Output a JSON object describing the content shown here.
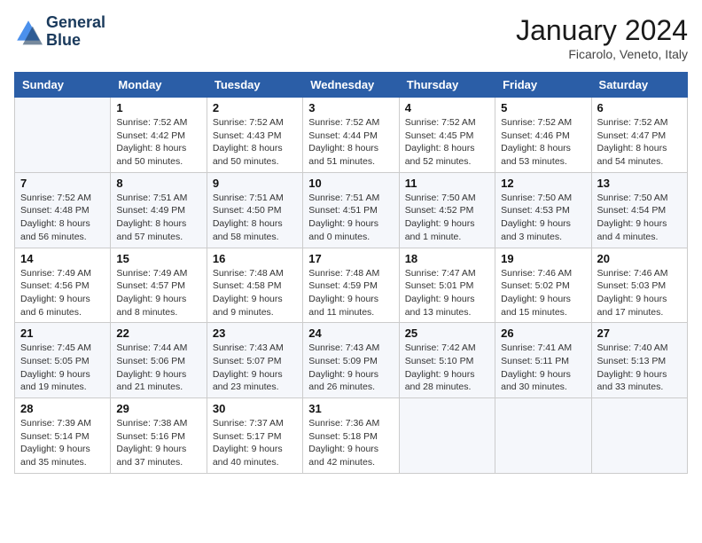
{
  "header": {
    "logo_line1": "General",
    "logo_line2": "Blue",
    "month": "January 2024",
    "location": "Ficarolo, Veneto, Italy"
  },
  "weekdays": [
    "Sunday",
    "Monday",
    "Tuesday",
    "Wednesday",
    "Thursday",
    "Friday",
    "Saturday"
  ],
  "weeks": [
    [
      {
        "day": "",
        "sunrise": "",
        "sunset": "",
        "daylight": ""
      },
      {
        "day": "1",
        "sunrise": "Sunrise: 7:52 AM",
        "sunset": "Sunset: 4:42 PM",
        "daylight": "Daylight: 8 hours and 50 minutes."
      },
      {
        "day": "2",
        "sunrise": "Sunrise: 7:52 AM",
        "sunset": "Sunset: 4:43 PM",
        "daylight": "Daylight: 8 hours and 50 minutes."
      },
      {
        "day": "3",
        "sunrise": "Sunrise: 7:52 AM",
        "sunset": "Sunset: 4:44 PM",
        "daylight": "Daylight: 8 hours and 51 minutes."
      },
      {
        "day": "4",
        "sunrise": "Sunrise: 7:52 AM",
        "sunset": "Sunset: 4:45 PM",
        "daylight": "Daylight: 8 hours and 52 minutes."
      },
      {
        "day": "5",
        "sunrise": "Sunrise: 7:52 AM",
        "sunset": "Sunset: 4:46 PM",
        "daylight": "Daylight: 8 hours and 53 minutes."
      },
      {
        "day": "6",
        "sunrise": "Sunrise: 7:52 AM",
        "sunset": "Sunset: 4:47 PM",
        "daylight": "Daylight: 8 hours and 54 minutes."
      }
    ],
    [
      {
        "day": "7",
        "sunrise": "Sunrise: 7:52 AM",
        "sunset": "Sunset: 4:48 PM",
        "daylight": "Daylight: 8 hours and 56 minutes."
      },
      {
        "day": "8",
        "sunrise": "Sunrise: 7:51 AM",
        "sunset": "Sunset: 4:49 PM",
        "daylight": "Daylight: 8 hours and 57 minutes."
      },
      {
        "day": "9",
        "sunrise": "Sunrise: 7:51 AM",
        "sunset": "Sunset: 4:50 PM",
        "daylight": "Daylight: 8 hours and 58 minutes."
      },
      {
        "day": "10",
        "sunrise": "Sunrise: 7:51 AM",
        "sunset": "Sunset: 4:51 PM",
        "daylight": "Daylight: 9 hours and 0 minutes."
      },
      {
        "day": "11",
        "sunrise": "Sunrise: 7:50 AM",
        "sunset": "Sunset: 4:52 PM",
        "daylight": "Daylight: 9 hours and 1 minute."
      },
      {
        "day": "12",
        "sunrise": "Sunrise: 7:50 AM",
        "sunset": "Sunset: 4:53 PM",
        "daylight": "Daylight: 9 hours and 3 minutes."
      },
      {
        "day": "13",
        "sunrise": "Sunrise: 7:50 AM",
        "sunset": "Sunset: 4:54 PM",
        "daylight": "Daylight: 9 hours and 4 minutes."
      }
    ],
    [
      {
        "day": "14",
        "sunrise": "Sunrise: 7:49 AM",
        "sunset": "Sunset: 4:56 PM",
        "daylight": "Daylight: 9 hours and 6 minutes."
      },
      {
        "day": "15",
        "sunrise": "Sunrise: 7:49 AM",
        "sunset": "Sunset: 4:57 PM",
        "daylight": "Daylight: 9 hours and 8 minutes."
      },
      {
        "day": "16",
        "sunrise": "Sunrise: 7:48 AM",
        "sunset": "Sunset: 4:58 PM",
        "daylight": "Daylight: 9 hours and 9 minutes."
      },
      {
        "day": "17",
        "sunrise": "Sunrise: 7:48 AM",
        "sunset": "Sunset: 4:59 PM",
        "daylight": "Daylight: 9 hours and 11 minutes."
      },
      {
        "day": "18",
        "sunrise": "Sunrise: 7:47 AM",
        "sunset": "Sunset: 5:01 PM",
        "daylight": "Daylight: 9 hours and 13 minutes."
      },
      {
        "day": "19",
        "sunrise": "Sunrise: 7:46 AM",
        "sunset": "Sunset: 5:02 PM",
        "daylight": "Daylight: 9 hours and 15 minutes."
      },
      {
        "day": "20",
        "sunrise": "Sunrise: 7:46 AM",
        "sunset": "Sunset: 5:03 PM",
        "daylight": "Daylight: 9 hours and 17 minutes."
      }
    ],
    [
      {
        "day": "21",
        "sunrise": "Sunrise: 7:45 AM",
        "sunset": "Sunset: 5:05 PM",
        "daylight": "Daylight: 9 hours and 19 minutes."
      },
      {
        "day": "22",
        "sunrise": "Sunrise: 7:44 AM",
        "sunset": "Sunset: 5:06 PM",
        "daylight": "Daylight: 9 hours and 21 minutes."
      },
      {
        "day": "23",
        "sunrise": "Sunrise: 7:43 AM",
        "sunset": "Sunset: 5:07 PM",
        "daylight": "Daylight: 9 hours and 23 minutes."
      },
      {
        "day": "24",
        "sunrise": "Sunrise: 7:43 AM",
        "sunset": "Sunset: 5:09 PM",
        "daylight": "Daylight: 9 hours and 26 minutes."
      },
      {
        "day": "25",
        "sunrise": "Sunrise: 7:42 AM",
        "sunset": "Sunset: 5:10 PM",
        "daylight": "Daylight: 9 hours and 28 minutes."
      },
      {
        "day": "26",
        "sunrise": "Sunrise: 7:41 AM",
        "sunset": "Sunset: 5:11 PM",
        "daylight": "Daylight: 9 hours and 30 minutes."
      },
      {
        "day": "27",
        "sunrise": "Sunrise: 7:40 AM",
        "sunset": "Sunset: 5:13 PM",
        "daylight": "Daylight: 9 hours and 33 minutes."
      }
    ],
    [
      {
        "day": "28",
        "sunrise": "Sunrise: 7:39 AM",
        "sunset": "Sunset: 5:14 PM",
        "daylight": "Daylight: 9 hours and 35 minutes."
      },
      {
        "day": "29",
        "sunrise": "Sunrise: 7:38 AM",
        "sunset": "Sunset: 5:16 PM",
        "daylight": "Daylight: 9 hours and 37 minutes."
      },
      {
        "day": "30",
        "sunrise": "Sunrise: 7:37 AM",
        "sunset": "Sunset: 5:17 PM",
        "daylight": "Daylight: 9 hours and 40 minutes."
      },
      {
        "day": "31",
        "sunrise": "Sunrise: 7:36 AM",
        "sunset": "Sunset: 5:18 PM",
        "daylight": "Daylight: 9 hours and 42 minutes."
      },
      {
        "day": "",
        "sunrise": "",
        "sunset": "",
        "daylight": ""
      },
      {
        "day": "",
        "sunrise": "",
        "sunset": "",
        "daylight": ""
      },
      {
        "day": "",
        "sunrise": "",
        "sunset": "",
        "daylight": ""
      }
    ]
  ]
}
